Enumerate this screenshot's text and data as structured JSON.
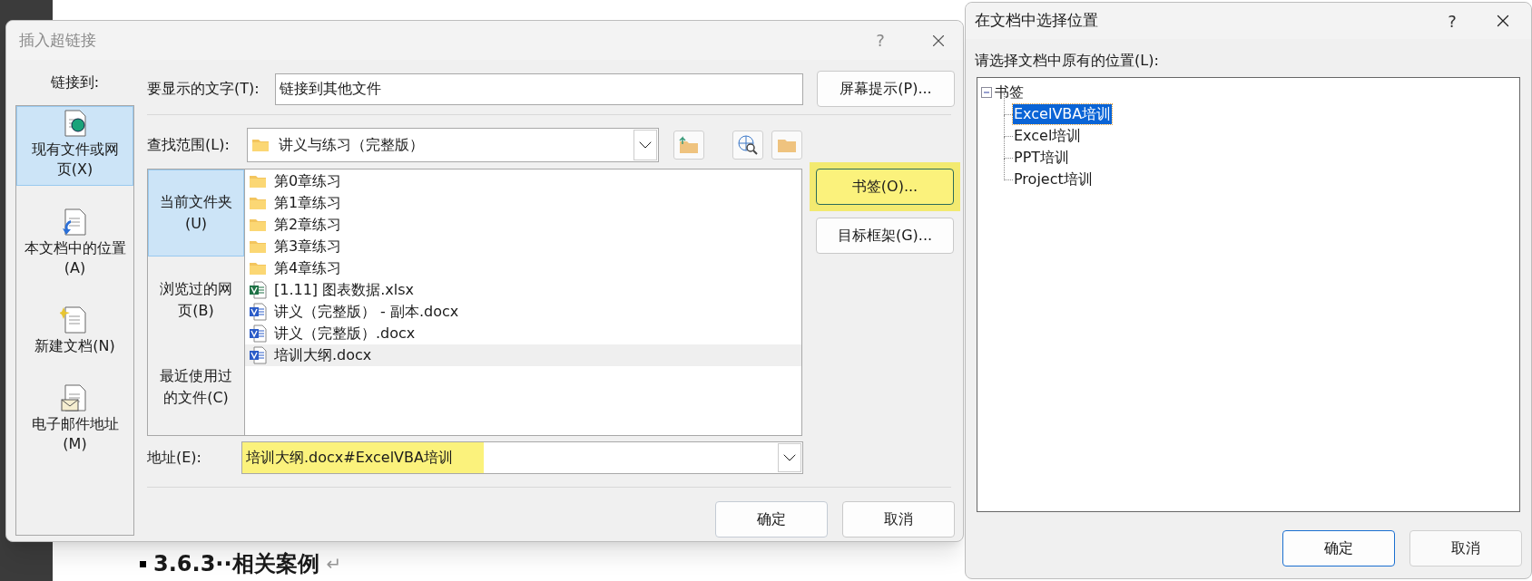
{
  "document": {
    "heading": "3.6.3··相关案例",
    "return_mark": "↵"
  },
  "hyperlink_dialog": {
    "title": "插入超链接",
    "help": "?",
    "link_to_label": "链接到:",
    "link_types": [
      {
        "label": "现有文件或网页(X)",
        "selected": true,
        "kind": "file"
      },
      {
        "label": "本文档中的位置(A)",
        "selected": false,
        "kind": "place"
      },
      {
        "label": "新建文档(N)",
        "selected": false,
        "kind": "new"
      },
      {
        "label": "电子邮件地址(M)",
        "selected": false,
        "kind": "email"
      }
    ],
    "display_text": {
      "label": "要显示的文字(T):",
      "value": "链接到其他文件"
    },
    "screen_tip_button": "屏幕提示(P)...",
    "look_in": {
      "label": "查找范围(L):",
      "value": "讲义与练习（完整版）"
    },
    "nav": [
      {
        "label": "当前文件夹(U)",
        "selected": true
      },
      {
        "label": "浏览过的网页(B)",
        "selected": false
      },
      {
        "label": "最近使用过的文件(C)",
        "selected": false
      }
    ],
    "files": [
      {
        "name": "第0章练习",
        "kind": "folder",
        "hovered": false
      },
      {
        "name": "第1章练习",
        "kind": "folder",
        "hovered": false
      },
      {
        "name": "第2章练习",
        "kind": "folder",
        "hovered": false
      },
      {
        "name": "第3章练习",
        "kind": "folder",
        "hovered": false
      },
      {
        "name": "第4章练习",
        "kind": "folder",
        "hovered": false
      },
      {
        "name": "[1.11] 图表数据.xlsx",
        "kind": "excel",
        "hovered": false
      },
      {
        "name": "讲义（完整版） - 副本.docx",
        "kind": "word",
        "hovered": false
      },
      {
        "name": "讲义（完整版）.docx",
        "kind": "word",
        "hovered": false
      },
      {
        "name": "培训大纲.docx",
        "kind": "word",
        "hovered": true
      }
    ],
    "bookmark_button": {
      "label": "书签(O)...",
      "highlighted": true
    },
    "target_frame_button": {
      "label": "目标框架(G)...",
      "highlighted": false
    },
    "address": {
      "label": "地址(E):",
      "value": "培训大纲.docx#ExcelVBA培训",
      "highlighted": true
    },
    "ok": "确定",
    "cancel": "取消"
  },
  "bookmark_dialog": {
    "title": "在文档中选择位置",
    "help": "?",
    "prompt": "请选择文档中原有的位置(L):",
    "tree": [
      {
        "label": "书签",
        "expanded": true,
        "selected": false,
        "children": [
          {
            "label": "ExcelVBA培训",
            "selected": true
          },
          {
            "label": "Excel培训",
            "selected": false
          },
          {
            "label": "PPT培训",
            "selected": false
          },
          {
            "label": "Project培训",
            "selected": false
          }
        ]
      }
    ],
    "ok": "确定",
    "cancel": "取消"
  }
}
